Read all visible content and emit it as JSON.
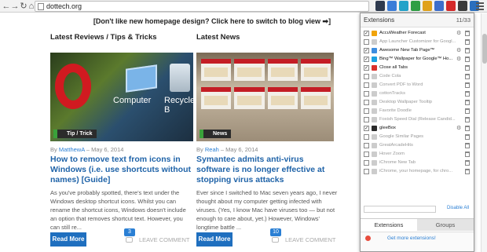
{
  "browser": {
    "url": "dottech.org",
    "back_glyph": "←",
    "forward_glyph": "→",
    "reload_glyph": "↻",
    "home_glyph": "⌂",
    "ext_icons": [
      {
        "name": "ext-icon-1",
        "color": "#2f3b4f"
      },
      {
        "name": "ext-icon-2",
        "color": "#3b7dd8"
      },
      {
        "name": "ext-icon-3",
        "color": "#22a2c9"
      },
      {
        "name": "ext-icon-4",
        "color": "#2e9e44"
      },
      {
        "name": "ext-icon-5",
        "color": "#e0a21b"
      },
      {
        "name": "ext-icon-6",
        "color": "#3d6fcc"
      },
      {
        "name": "ext-icon-7",
        "color": "#d42a2a"
      },
      {
        "name": "ext-icon-8",
        "color": "#3b3b3b"
      },
      {
        "name": "ext-icon-9",
        "color": "#2b6fbe"
      }
    ]
  },
  "page": {
    "banner": "[Don't like new homepage design? Click here to switch to blog view ➡]",
    "left_section_title": "Latest Reviews / Tips & Tricks",
    "right_section_title": "Latest News",
    "articles": [
      {
        "tag": "Tip / Trick",
        "image_label_1": "Computer",
        "image_label_2": "Recycle B",
        "by": "By",
        "author": "MatthewA",
        "date": "–  May 6, 2014",
        "headline": "How to remove text from icons in Windows (i.e. use shortcuts without names) [Guide]",
        "excerpt": "As you've probably spotted, there's text under the Windows desktop shortcut icons. Whilst you can rename the shortcut icons, Windows doesn't include an option that removes shortcut text. However, you can still re...",
        "read_more": "Read More",
        "comments": "3",
        "leave_comment": "LEAVE COMMENT"
      },
      {
        "tag": "News",
        "by": "By",
        "author": "Reah",
        "date": "–  May 6, 2014",
        "headline": "Symantec admits anti-virus software is no longer effective at stopping virus attacks",
        "excerpt": "Ever since I switched to Mac seven years ago, I never thought about my computer getting infected with viruses. (Yes, I know Mac have viruses too — but not enough to care about, yet.) However, Windows' longtime battle ...",
        "read_more": "Read More",
        "comments": "10",
        "leave_comment": "LEAVE COMMENT"
      }
    ]
  },
  "extensions_popup": {
    "title": "Extensions",
    "count": "11/33",
    "items": [
      {
        "label": "AccuWeather Forecast",
        "enabled": true,
        "color": "#f0a30a",
        "options": true
      },
      {
        "label": "App Launcher Customizer for Googl...",
        "enabled": false,
        "color": "#cccccc",
        "options": false
      },
      {
        "label": "Awesome New Tab Page™",
        "enabled": true,
        "color": "#3c8de0",
        "options": true
      },
      {
        "label": "Bing™ Wallpaper for Google™ Ho...",
        "enabled": true,
        "color": "#1ba1e2",
        "options": true
      },
      {
        "label": "Close all Tabs",
        "enabled": true,
        "color": "#d9302c",
        "options": false
      },
      {
        "label": "Code Cola",
        "enabled": false,
        "color": "#cccccc",
        "options": false
      },
      {
        "label": "Convert PDF to Word",
        "enabled": false,
        "color": "#cccccc",
        "options": false
      },
      {
        "label": "cottonTracks",
        "enabled": false,
        "color": "#cccccc",
        "options": false
      },
      {
        "label": "Desktop Wallpaper Tooltip",
        "enabled": false,
        "color": "#cccccc",
        "options": false
      },
      {
        "label": "Favorite Doodle",
        "enabled": false,
        "color": "#cccccc",
        "options": false
      },
      {
        "label": "Foxish Speed Dial (Release Candid...",
        "enabled": false,
        "color": "#cccccc",
        "options": false
      },
      {
        "label": "gleeBox",
        "enabled": true,
        "color": "#2a2a2a",
        "options": true
      },
      {
        "label": "Google Similar Pages",
        "enabled": false,
        "color": "#cccccc",
        "options": false
      },
      {
        "label": "GreatArcadeHits",
        "enabled": false,
        "color": "#cccccc",
        "options": false
      },
      {
        "label": "Hover Zoom",
        "enabled": false,
        "color": "#cccccc",
        "options": false
      },
      {
        "label": "iChrome New Tab",
        "enabled": false,
        "color": "#cccccc",
        "options": false
      },
      {
        "label": "iChrome, your homepage, for chro...",
        "enabled": false,
        "color": "#cccccc",
        "options": false
      }
    ],
    "disable_all": "Disable All",
    "tabs": [
      "Extensions",
      "Groups"
    ],
    "get_more": "Get more extensions!"
  }
}
